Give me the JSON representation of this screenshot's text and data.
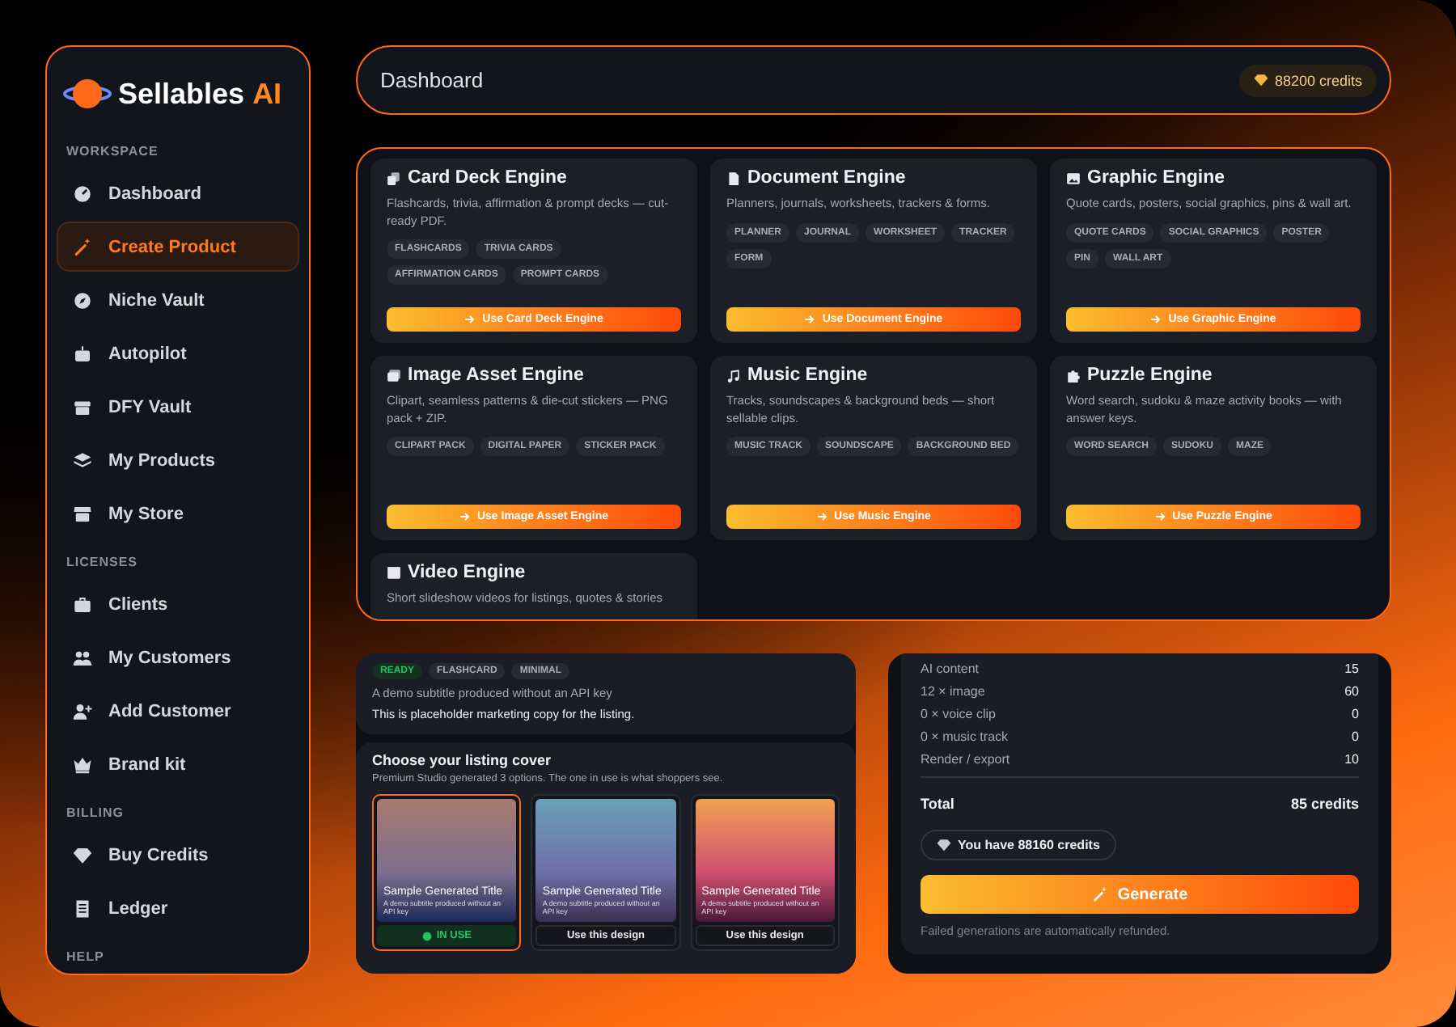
{
  "sidebar": {
    "logo": {
      "name": "Sellables",
      "suffix": "AI"
    },
    "sections": [
      {
        "heading": "WORKSPACE",
        "items": [
          {
            "label": "Dashboard",
            "selected": false
          },
          {
            "label": "Create Product",
            "selected": true
          },
          {
            "label": "Niche Vault",
            "selected": false
          },
          {
            "label": "Autopilot",
            "selected": false
          },
          {
            "label": "DFY Vault",
            "selected": false
          },
          {
            "label": "My Products",
            "selected": false
          },
          {
            "label": "My Store",
            "selected": false
          }
        ]
      },
      {
        "heading": "LICENSES",
        "items": [
          {
            "label": "Clients",
            "selected": false
          },
          {
            "label": "My Customers",
            "selected": false
          },
          {
            "label": "Add Customer",
            "selected": false
          },
          {
            "label": "Brand kit",
            "selected": false
          }
        ]
      },
      {
        "heading": "BILLING",
        "items": [
          {
            "label": "Buy Credits",
            "selected": false
          },
          {
            "label": "Ledger",
            "selected": false
          }
        ]
      },
      {
        "heading": "HELP"
      }
    ]
  },
  "header": {
    "title": "Dashboard",
    "credits": "88200 credits"
  },
  "engines": [
    {
      "title": "Card Deck Engine",
      "description": "Flashcards, trivia, affirmation & prompt decks — cut-ready PDF.",
      "tags": [
        "FLASHCARDS",
        "TRIVIA CARDS",
        "AFFIRMATION CARDS",
        "PROMPT CARDS"
      ],
      "button": "Use Card Deck Engine"
    },
    {
      "title": "Document Engine",
      "description": "Planners, journals, worksheets, trackers & forms.",
      "tags": [
        "PLANNER",
        "JOURNAL",
        "WORKSHEET",
        "TRACKER",
        "FORM"
      ],
      "button": "Use Document Engine"
    },
    {
      "title": "Graphic Engine",
      "description": "Quote cards, posters, social graphics, pins & wall art.",
      "tags": [
        "QUOTE CARDS",
        "SOCIAL GRAPHICS",
        "POSTER",
        "PIN",
        "WALL ART"
      ],
      "button": "Use Graphic Engine"
    },
    {
      "title": "Image Asset Engine",
      "description": "Clipart, seamless patterns & die-cut stickers — PNG pack + ZIP.",
      "tags": [
        "CLIPART PACK",
        "DIGITAL PAPER",
        "STICKER PACK"
      ],
      "button": "Use Image Asset Engine"
    },
    {
      "title": "Music Engine",
      "description": "Tracks, soundscapes & background beds — short sellable clips.",
      "tags": [
        "MUSIC TRACK",
        "SOUNDSCAPE",
        "BACKGROUND BED"
      ],
      "button": "Use Music Engine"
    },
    {
      "title": "Puzzle Engine",
      "description": "Word search, sudoku & maze activity books — with answer keys.",
      "tags": [
        "WORD SEARCH",
        "SUDOKU",
        "MAZE"
      ],
      "button": "Use Puzzle Engine"
    },
    {
      "title": "Video Engine",
      "description": "Short slideshow videos for listings, quotes & stories"
    }
  ],
  "listing": {
    "tags": [
      {
        "label": "READY",
        "kind": "status"
      },
      {
        "label": "FLASHCARD",
        "kind": "plain"
      },
      {
        "label": "MINIMAL",
        "kind": "plain"
      }
    ],
    "subtitle": "A demo subtitle produced without an API key",
    "copy": "This is placeholder marketing copy for the listing.",
    "cover_title": "Choose your listing cover",
    "cover_note": "Premium Studio generated 3 options. The one in use is what shoppers see.",
    "covers": [
      {
        "title": "Sample Generated Title",
        "subtitle": "A demo subtitle produced without an API key",
        "button": "IN USE",
        "selected": true
      },
      {
        "title": "Sample Generated Title",
        "subtitle": "A demo subtitle produced without an API key",
        "button": "Use this design",
        "selected": false
      },
      {
        "title": "Sample Generated Title",
        "subtitle": "A demo subtitle produced without an API key",
        "button": "Use this design",
        "selected": false
      }
    ]
  },
  "cost": {
    "rows": [
      {
        "label": "AI content",
        "value": "15"
      },
      {
        "label": "12 × image",
        "value": "60"
      },
      {
        "label": "0 × voice clip",
        "value": "0"
      },
      {
        "label": "0 × music track",
        "value": "0"
      },
      {
        "label": "Render / export",
        "value": "10"
      }
    ],
    "total_label": "Total",
    "total_value": "85 credits",
    "balance": "You have 88160 credits",
    "button": "Generate",
    "note": "Failed generations are automatically refunded."
  }
}
